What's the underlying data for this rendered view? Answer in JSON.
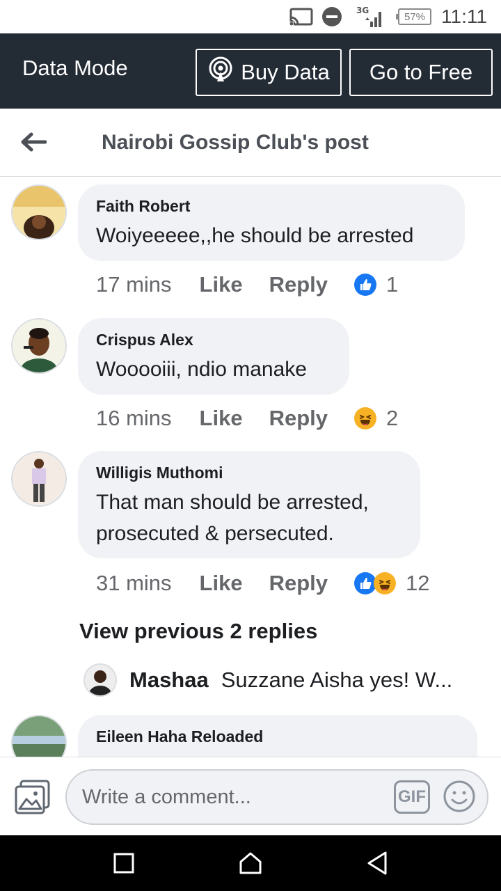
{
  "status_bar": {
    "battery": "57%",
    "time": "11:11",
    "network": "3G"
  },
  "data_mode": {
    "label": "Data Mode",
    "buy_label": "Buy Data",
    "free_label": "Go to Free"
  },
  "header": {
    "title": "Nairobi Gossip Club's post"
  },
  "comments": [
    {
      "author": "Faith Robert",
      "text": "Woiyeeeee,,he should be arrested",
      "time": "17 mins",
      "like": "Like",
      "reply": "Reply",
      "reactions": [
        "like"
      ],
      "count": "1"
    },
    {
      "author": "Crispus Alex",
      "text": "Wooooiii, ndio manake",
      "time": "16 mins",
      "like": "Like",
      "reply": "Reply",
      "reactions": [
        "haha"
      ],
      "count": "2"
    },
    {
      "author": "Willigis Muthomi",
      "text_line1": "That man should be arrested,",
      "text_line2": "prosecuted & persecuted.",
      "time": "31 mins",
      "like": "Like",
      "reply": "Reply",
      "reactions": [
        "like",
        "haha"
      ],
      "count": "12"
    },
    {
      "author": "Eileen Haha Reloaded"
    }
  ],
  "view_previous": "View previous 2 replies",
  "reply_preview": {
    "name": "Mashaa",
    "text": "Suzzane Aisha yes! W..."
  },
  "composer": {
    "placeholder": "Write a comment...",
    "gif_label": "GIF"
  },
  "colors": {
    "data_bar": "#232b35",
    "like_blue": "#1877f2",
    "haha_yellow": "#f7b125",
    "bubble": "#f0f2f5"
  }
}
